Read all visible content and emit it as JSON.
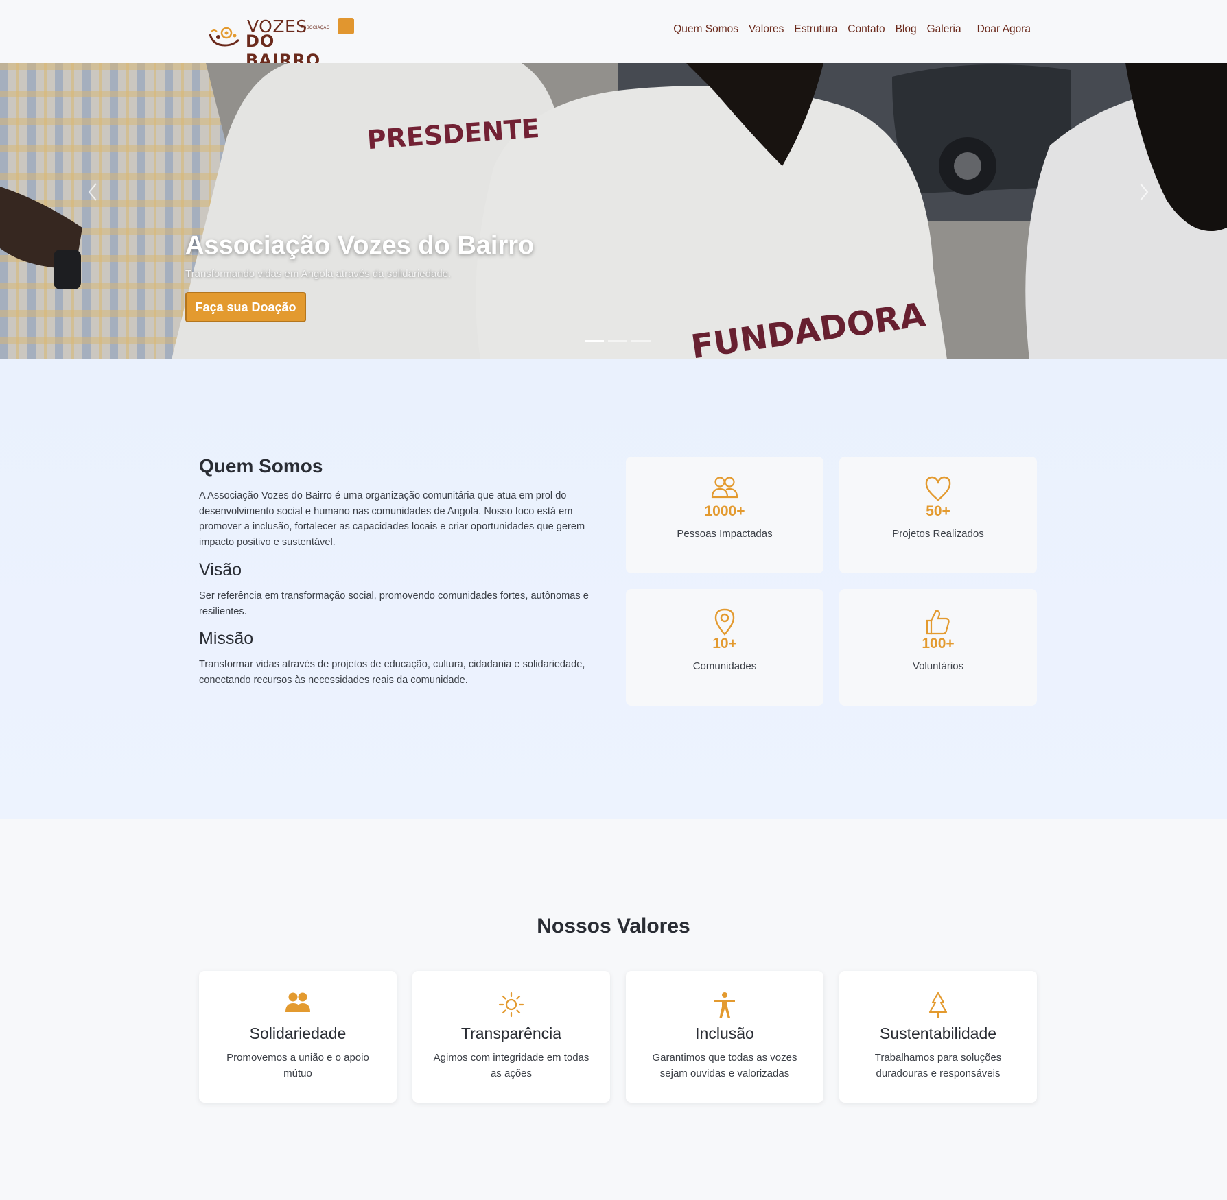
{
  "header": {
    "logo": {
      "line1": "VOZES",
      "small": "ASSOCIAÇÃO",
      "line2": "DO BAIRRO"
    },
    "nav": [
      "Quem Somos",
      "Valores",
      "Estrutura",
      "Contato",
      "Blog",
      "Galeria",
      "Doar Agora"
    ]
  },
  "hero": {
    "title": "Associação Vozes do Bairro",
    "subtitle": "Transformando vidas em Angola através da solidariedade.",
    "cta": "Faça sua Doação",
    "shirt_text_1": "PRESDENTE",
    "shirt_text_2": "FUNDADORA",
    "slides": 3,
    "active_slide": 1
  },
  "about": {
    "title": "Quem Somos",
    "text": "A Associação Vozes do Bairro é uma organização comunitária que atua em prol do desenvolvimento social e humano nas comunidades de Angola. Nosso foco está em promover a inclusão, fortalecer as capacidades locais e criar oportunidades que gerem impacto positivo e sustentável.",
    "vision_title": "Visão",
    "vision_text": "Ser referência em transformação social, promovendo comunidades fortes, autônomas e resilientes.",
    "mission_title": "Missão",
    "mission_text": "Transformar vidas através de projetos de educação, cultura, cidadania e solidariedade, conectando recursos às necessidades reais da comunidade.",
    "stats": [
      {
        "icon": "people-icon",
        "value": "1000+",
        "label": "Pessoas Impactadas"
      },
      {
        "icon": "heart-icon",
        "value": "50+",
        "label": "Projetos Realizados"
      },
      {
        "icon": "map-pin-icon",
        "value": "10+",
        "label": "Comunidades"
      },
      {
        "icon": "thumbs-up-icon",
        "value": "100+",
        "label": "Voluntários"
      }
    ]
  },
  "values": {
    "title": "Nossos Valores",
    "items": [
      {
        "icon": "users-icon",
        "name": "Solidariedade",
        "desc": "Promovemos a união e o apoio mútuo"
      },
      {
        "icon": "sun-icon",
        "name": "Transparência",
        "desc": "Agimos com integridade em todas as ações"
      },
      {
        "icon": "accessibility-icon",
        "name": "Inclusão",
        "desc": "Garantimos que todas as vozes sejam ouvidas e valorizadas"
      },
      {
        "icon": "tree-icon",
        "name": "Sustentabilidade",
        "desc": "Trabalhamos para soluções duradouras e responsáveis"
      }
    ]
  },
  "colors": {
    "accent": "#e39a2f",
    "brand": "#6b2a1c",
    "text": "#2a2d34",
    "about_bg": "#eaf1fd"
  }
}
